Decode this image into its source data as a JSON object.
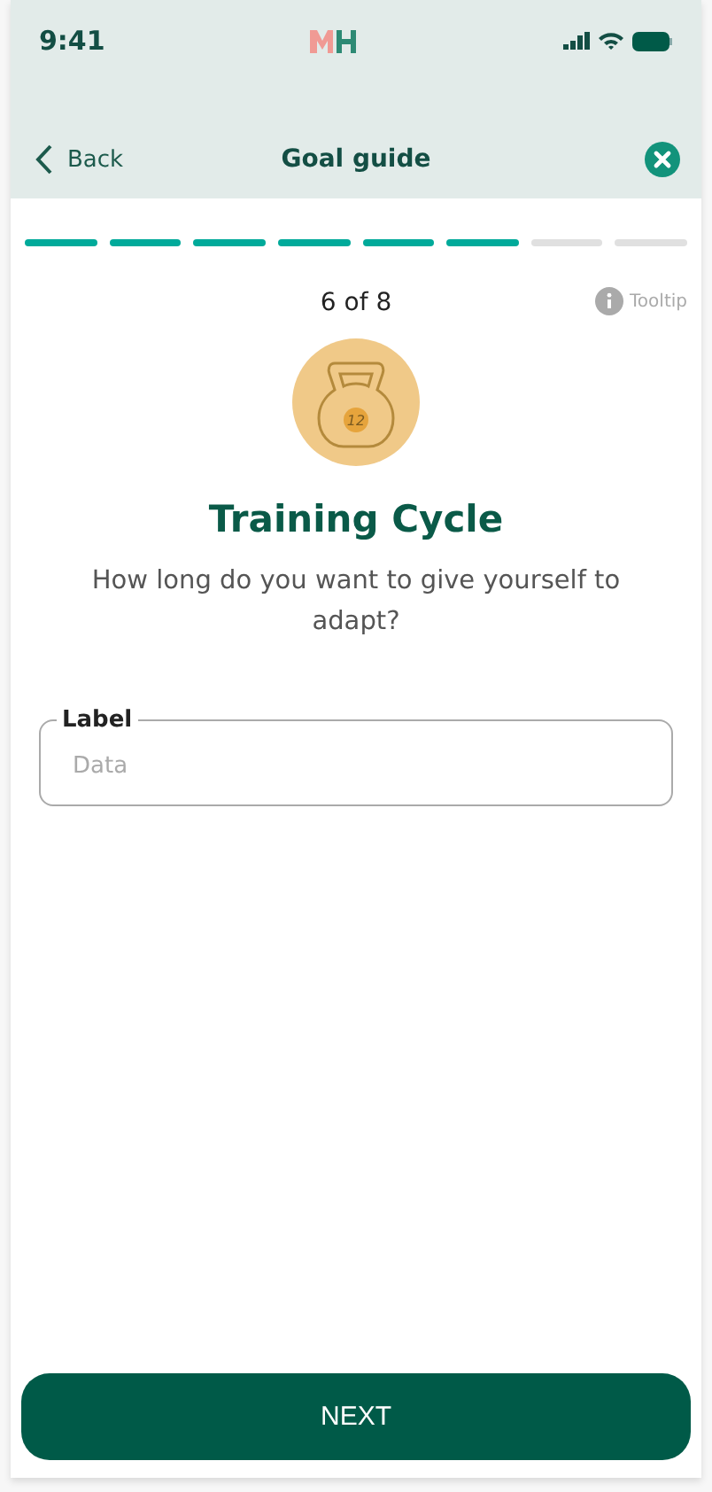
{
  "status_bar": {
    "time": "9:41"
  },
  "nav": {
    "back": "Back",
    "title": "Goal guide"
  },
  "progress": {
    "segments": [
      {
        "complete": true
      },
      {
        "complete": true
      },
      {
        "complete": true
      },
      {
        "complete": true
      },
      {
        "complete": true
      },
      {
        "complete": true
      },
      {
        "complete": false
      },
      {
        "complete": false
      }
    ]
  },
  "step": "6 of 8",
  "tooltip": "Tooltip",
  "badge": {
    "weight": "12"
  },
  "title": "Training Cycle",
  "question": "How long do you want to give yourself to adapt?",
  "field": {
    "label": "Label",
    "placeholder": "Data"
  },
  "button": "NEXT"
}
